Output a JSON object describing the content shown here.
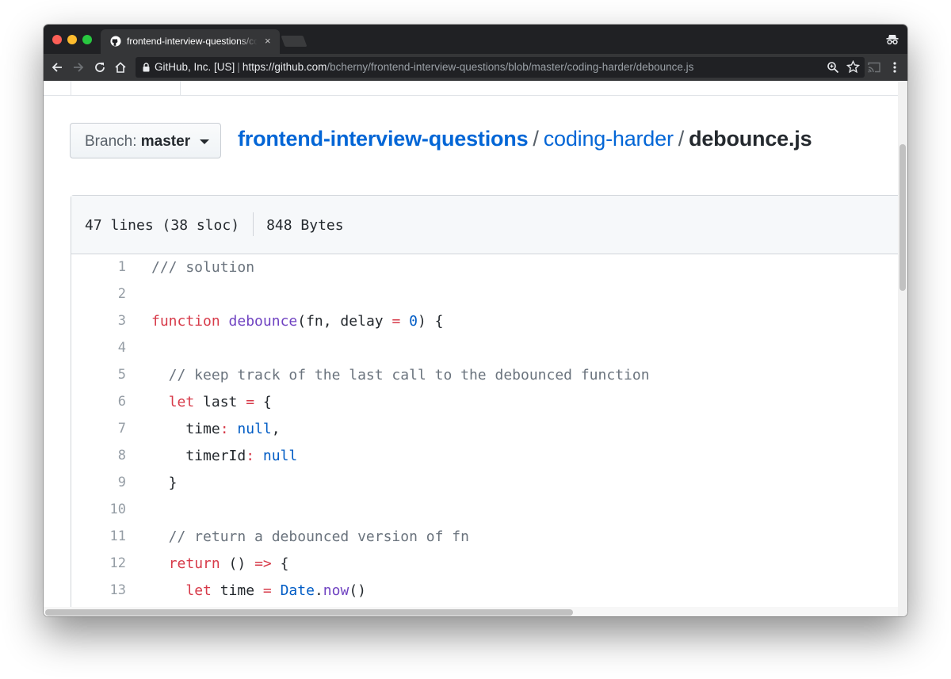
{
  "browser": {
    "tab_title": "frontend-interview-questions/coding-harder/debounce.js",
    "tab_close_glyph": "×",
    "site_identity": "GitHub, Inc. [US]",
    "url_base": "https://github.com",
    "url_path": "/bcherny/frontend-interview-questions/blob/master/coding-harder/debounce.js",
    "icons": [
      "github-favicon-icon",
      "incognito-icon",
      "back-arrow-icon",
      "forward-arrow-icon",
      "reload-icon",
      "home-icon",
      "lock-icon",
      "zoom-icon",
      "star-icon",
      "cast-icon",
      "menu-dots-icon"
    ]
  },
  "repo": {
    "branch_prefix": "Branch:",
    "branch_name": "master",
    "breadcrumb": {
      "repo": "frontend-interview-questions",
      "sep1": "/",
      "folder": "coding-harder",
      "sep2": "/",
      "file": "debounce.js"
    }
  },
  "file": {
    "lines_info": "47 lines (38 sloc)",
    "size_info": "848 Bytes",
    "lines": [
      {
        "num": "1",
        "tokens": [
          {
            "t": "/// solution",
            "c": "comment"
          }
        ]
      },
      {
        "num": "2",
        "tokens": []
      },
      {
        "num": "3",
        "tokens": [
          {
            "t": "function",
            "c": "keyword"
          },
          {
            "t": " ",
            "c": ""
          },
          {
            "t": "debounce",
            "c": "entity"
          },
          {
            "t": "(fn, delay ",
            "c": ""
          },
          {
            "t": "=",
            "c": "keyword"
          },
          {
            "t": " ",
            "c": ""
          },
          {
            "t": "0",
            "c": "constant"
          },
          {
            "t": ") {",
            "c": ""
          }
        ]
      },
      {
        "num": "4",
        "tokens": []
      },
      {
        "num": "5",
        "tokens": [
          {
            "t": "  // keep track of the last call to the debounced function",
            "c": "comment"
          }
        ]
      },
      {
        "num": "6",
        "tokens": [
          {
            "t": "  ",
            "c": ""
          },
          {
            "t": "let",
            "c": "keyword"
          },
          {
            "t": " last ",
            "c": ""
          },
          {
            "t": "=",
            "c": "keyword"
          },
          {
            "t": " {",
            "c": ""
          }
        ]
      },
      {
        "num": "7",
        "tokens": [
          {
            "t": "    time",
            "c": ""
          },
          {
            "t": ":",
            "c": "keyword"
          },
          {
            "t": " ",
            "c": ""
          },
          {
            "t": "null",
            "c": "constant"
          },
          {
            "t": ",",
            "c": ""
          }
        ]
      },
      {
        "num": "8",
        "tokens": [
          {
            "t": "    timerId",
            "c": ""
          },
          {
            "t": ":",
            "c": "keyword"
          },
          {
            "t": " ",
            "c": ""
          },
          {
            "t": "null",
            "c": "constant"
          }
        ]
      },
      {
        "num": "9",
        "tokens": [
          {
            "t": "  }",
            "c": ""
          }
        ]
      },
      {
        "num": "10",
        "tokens": []
      },
      {
        "num": "11",
        "tokens": [
          {
            "t": "  // return a debounced version of fn",
            "c": "comment"
          }
        ]
      },
      {
        "num": "12",
        "tokens": [
          {
            "t": "  ",
            "c": ""
          },
          {
            "t": "return",
            "c": "keyword"
          },
          {
            "t": " () ",
            "c": ""
          },
          {
            "t": "=>",
            "c": "keyword"
          },
          {
            "t": " {",
            "c": ""
          }
        ]
      },
      {
        "num": "13",
        "tokens": [
          {
            "t": "    ",
            "c": ""
          },
          {
            "t": "let",
            "c": "keyword"
          },
          {
            "t": " time ",
            "c": ""
          },
          {
            "t": "=",
            "c": "keyword"
          },
          {
            "t": " ",
            "c": ""
          },
          {
            "t": "Date",
            "c": "constant"
          },
          {
            "t": ".",
            "c": ""
          },
          {
            "t": "now",
            "c": "entity"
          },
          {
            "t": "()",
            "c": ""
          }
        ]
      }
    ]
  },
  "colors": {
    "link": "#0366d6",
    "comment": "#6a737d",
    "keyword": "#d73a49",
    "entity": "#6f42c1",
    "constant": "#005cc5"
  }
}
